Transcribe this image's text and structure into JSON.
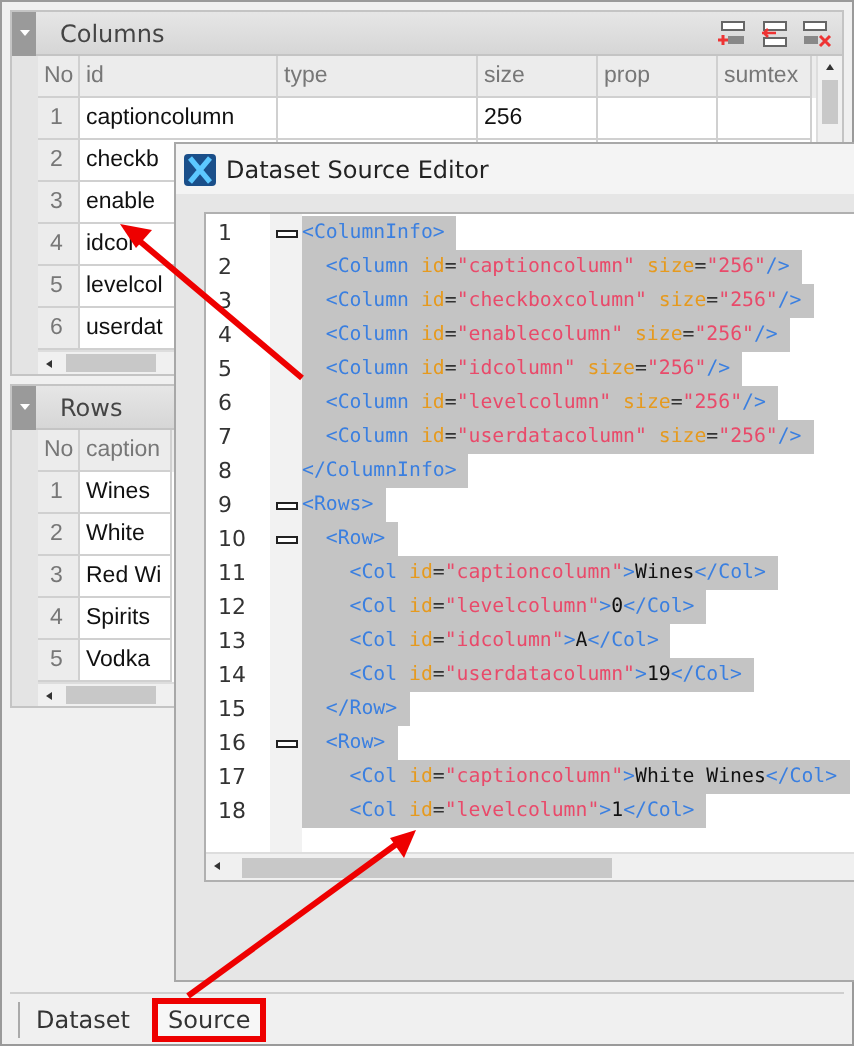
{
  "columns_panel": {
    "title": "Columns",
    "grid": {
      "columns": [
        "No",
        "id",
        "type",
        "size",
        "prop",
        "sumtex"
      ],
      "rows": [
        [
          "1",
          "captioncolumn",
          "",
          "256",
          "",
          ""
        ],
        [
          "2",
          "checkb"
        ],
        [
          "3",
          "enable"
        ],
        [
          "4",
          "idcol"
        ],
        [
          "5",
          "levelcol"
        ],
        [
          "6",
          "userdat"
        ]
      ]
    }
  },
  "rows_panel": {
    "title": "Rows",
    "grid": {
      "columns": [
        "No",
        "caption"
      ],
      "rows": [
        [
          "1",
          "Wines"
        ],
        [
          "2",
          "White"
        ],
        [
          "3",
          "Red Wi"
        ],
        [
          "4",
          "Spirits"
        ],
        [
          "5",
          "Vodka"
        ]
      ]
    }
  },
  "tabs": [
    {
      "label": "Dataset",
      "selected": false
    },
    {
      "label": "Source",
      "selected": true
    }
  ],
  "editor": {
    "title": "Dataset Source Editor",
    "lines": [
      {
        "number": "1",
        "fold": true,
        "tokens": [
          {
            "kind": "tag",
            "text": "<ColumnInfo>"
          }
        ]
      },
      {
        "number": "2",
        "fold": false,
        "tokens": [
          {
            "kind": "tag",
            "text": "  <Column"
          },
          {
            "kind": "attr",
            "text": " id"
          },
          {
            "kind": "punct",
            "text": "="
          },
          {
            "kind": "value",
            "text": "\"captioncolumn\""
          },
          {
            "kind": "attr",
            "text": " size"
          },
          {
            "kind": "punct",
            "text": "="
          },
          {
            "kind": "value",
            "text": "\"256\""
          },
          {
            "kind": "tag",
            "text": "/>"
          }
        ]
      },
      {
        "number": "3",
        "fold": false,
        "tokens": [
          {
            "kind": "tag",
            "text": "  <Column"
          },
          {
            "kind": "attr",
            "text": " id"
          },
          {
            "kind": "punct",
            "text": "="
          },
          {
            "kind": "value",
            "text": "\"checkboxcolumn\""
          },
          {
            "kind": "attr",
            "text": " size"
          },
          {
            "kind": "punct",
            "text": "="
          },
          {
            "kind": "value",
            "text": "\"256\""
          },
          {
            "kind": "tag",
            "text": "/>"
          }
        ]
      },
      {
        "number": "4",
        "fold": false,
        "tokens": [
          {
            "kind": "tag",
            "text": "  <Column"
          },
          {
            "kind": "attr",
            "text": " id"
          },
          {
            "kind": "punct",
            "text": "="
          },
          {
            "kind": "value",
            "text": "\"enablecolumn\""
          },
          {
            "kind": "attr",
            "text": " size"
          },
          {
            "kind": "punct",
            "text": "="
          },
          {
            "kind": "value",
            "text": "\"256\""
          },
          {
            "kind": "tag",
            "text": "/>"
          }
        ]
      },
      {
        "number": "5",
        "fold": false,
        "tokens": [
          {
            "kind": "tag",
            "text": "  <Column"
          },
          {
            "kind": "attr",
            "text": " id"
          },
          {
            "kind": "punct",
            "text": "="
          },
          {
            "kind": "value",
            "text": "\"idcolumn\""
          },
          {
            "kind": "attr",
            "text": " size"
          },
          {
            "kind": "punct",
            "text": "="
          },
          {
            "kind": "value",
            "text": "\"256\""
          },
          {
            "kind": "tag",
            "text": "/>"
          }
        ]
      },
      {
        "number": "6",
        "fold": false,
        "tokens": [
          {
            "kind": "tag",
            "text": "  <Column"
          },
          {
            "kind": "attr",
            "text": " id"
          },
          {
            "kind": "punct",
            "text": "="
          },
          {
            "kind": "value",
            "text": "\"levelcolumn\""
          },
          {
            "kind": "attr",
            "text": " size"
          },
          {
            "kind": "punct",
            "text": "="
          },
          {
            "kind": "value",
            "text": "\"256\""
          },
          {
            "kind": "tag",
            "text": "/>"
          }
        ]
      },
      {
        "number": "7",
        "fold": false,
        "tokens": [
          {
            "kind": "tag",
            "text": "  <Column"
          },
          {
            "kind": "attr",
            "text": " id"
          },
          {
            "kind": "punct",
            "text": "="
          },
          {
            "kind": "value",
            "text": "\"userdatacolumn\""
          },
          {
            "kind": "attr",
            "text": " size"
          },
          {
            "kind": "punct",
            "text": "="
          },
          {
            "kind": "value",
            "text": "\"256\""
          },
          {
            "kind": "tag",
            "text": "/>"
          }
        ]
      },
      {
        "number": "8",
        "fold": false,
        "tokens": [
          {
            "kind": "tag",
            "text": "</ColumnInfo>"
          }
        ]
      },
      {
        "number": "9",
        "fold": true,
        "tokens": [
          {
            "kind": "tag",
            "text": "<Rows>"
          }
        ]
      },
      {
        "number": "10",
        "fold": true,
        "tokens": [
          {
            "kind": "tag",
            "text": "  <Row>"
          }
        ]
      },
      {
        "number": "11",
        "fold": false,
        "tokens": [
          {
            "kind": "tag",
            "text": "    <Col"
          },
          {
            "kind": "attr",
            "text": " id"
          },
          {
            "kind": "punct",
            "text": "="
          },
          {
            "kind": "value",
            "text": "\"captioncolumn\""
          },
          {
            "kind": "tag",
            "text": ">"
          },
          {
            "kind": "text",
            "text": "Wines"
          },
          {
            "kind": "tag",
            "text": "</Col>"
          }
        ]
      },
      {
        "number": "12",
        "fold": false,
        "tokens": [
          {
            "kind": "tag",
            "text": "    <Col"
          },
          {
            "kind": "attr",
            "text": " id"
          },
          {
            "kind": "punct",
            "text": "="
          },
          {
            "kind": "value",
            "text": "\"levelcolumn\""
          },
          {
            "kind": "tag",
            "text": ">"
          },
          {
            "kind": "text",
            "text": "0"
          },
          {
            "kind": "tag",
            "text": "</Col>"
          }
        ]
      },
      {
        "number": "13",
        "fold": false,
        "tokens": [
          {
            "kind": "tag",
            "text": "    <Col"
          },
          {
            "kind": "attr",
            "text": " id"
          },
          {
            "kind": "punct",
            "text": "="
          },
          {
            "kind": "value",
            "text": "\"idcolumn\""
          },
          {
            "kind": "tag",
            "text": ">"
          },
          {
            "kind": "text",
            "text": "A"
          },
          {
            "kind": "tag",
            "text": "</Col>"
          }
        ]
      },
      {
        "number": "14",
        "fold": false,
        "tokens": [
          {
            "kind": "tag",
            "text": "    <Col"
          },
          {
            "kind": "attr",
            "text": " id"
          },
          {
            "kind": "punct",
            "text": "="
          },
          {
            "kind": "value",
            "text": "\"userdatacolumn\""
          },
          {
            "kind": "tag",
            "text": ">"
          },
          {
            "kind": "text",
            "text": "19"
          },
          {
            "kind": "tag",
            "text": "</Col>"
          }
        ]
      },
      {
        "number": "15",
        "fold": false,
        "tokens": [
          {
            "kind": "tag",
            "text": "  </Row>"
          }
        ]
      },
      {
        "number": "16",
        "fold": true,
        "tokens": [
          {
            "kind": "tag",
            "text": "  <Row>"
          }
        ]
      },
      {
        "number": "17",
        "fold": false,
        "tokens": [
          {
            "kind": "tag",
            "text": "    <Col"
          },
          {
            "kind": "attr",
            "text": " id"
          },
          {
            "kind": "punct",
            "text": "="
          },
          {
            "kind": "value",
            "text": "\"captioncolumn\""
          },
          {
            "kind": "tag",
            "text": ">"
          },
          {
            "kind": "text",
            "text": "White Wines"
          },
          {
            "kind": "tag",
            "text": "</Col>"
          }
        ]
      },
      {
        "number": "18",
        "fold": false,
        "tokens": [
          {
            "kind": "tag",
            "text": "    <Col"
          },
          {
            "kind": "attr",
            "text": " id"
          },
          {
            "kind": "punct",
            "text": "="
          },
          {
            "kind": "value",
            "text": "\"levelcolumn\""
          },
          {
            "kind": "tag",
            "text": ">"
          },
          {
            "kind": "text",
            "text": "1"
          },
          {
            "kind": "tag",
            "text": "</Col>"
          }
        ]
      }
    ]
  }
}
